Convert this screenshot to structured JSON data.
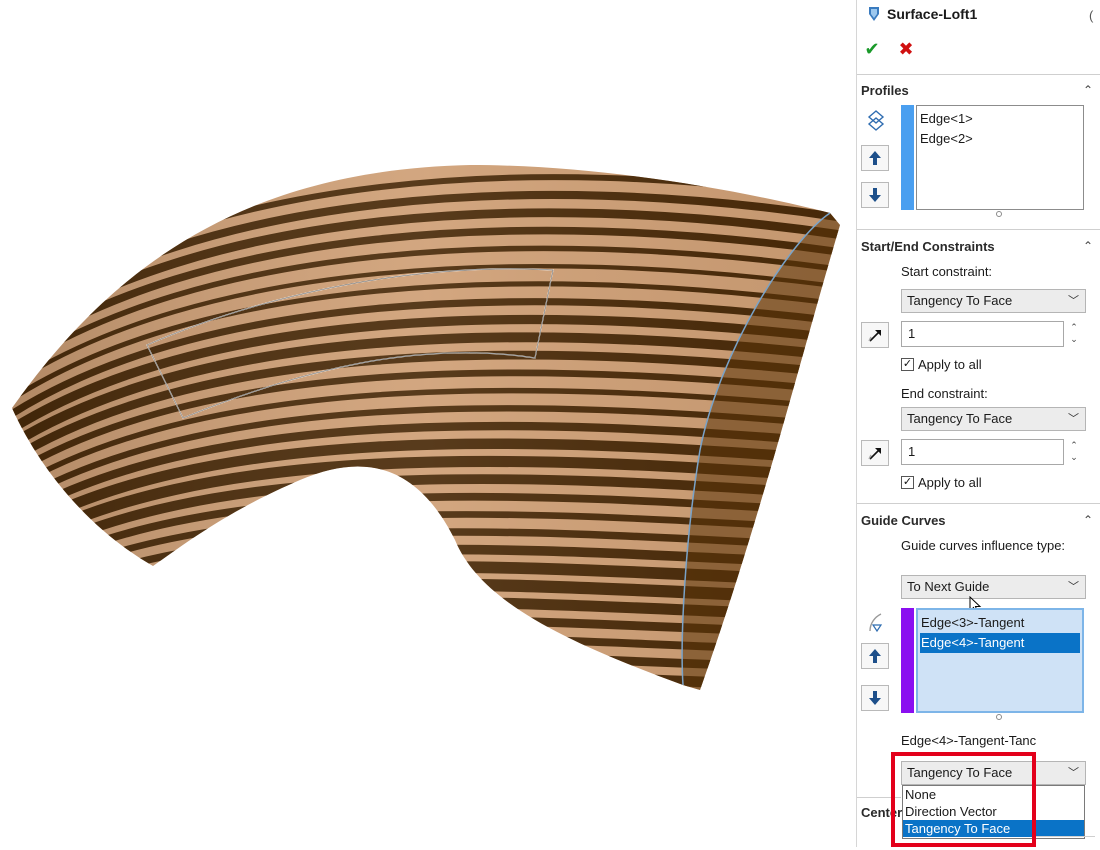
{
  "feature": {
    "title": "Surface-Loft1",
    "icon": "surface-loft-icon",
    "ok_icon": "checkmark-icon",
    "cancel_icon": "x-icon",
    "ok_glyph": "✔",
    "cancel_glyph": "✖"
  },
  "profiles": {
    "header": "Profiles",
    "items": [
      "Edge<1>",
      "Edge<2>"
    ],
    "bar_color": "#4a9ff0"
  },
  "constraints": {
    "header": "Start/End Constraints",
    "start_label": "Start constraint:",
    "start_value": "Tangency To Face",
    "start_length": "1",
    "start_apply_all": "Apply to all",
    "end_label": "End constraint:",
    "end_value": "Tangency To Face",
    "end_length": "1",
    "end_apply_all": "Apply to all"
  },
  "guides": {
    "header": "Guide Curves",
    "influence_label": "Guide curves influence type:",
    "influence_value": "To Next Guide",
    "items": [
      "Edge<3>-Tangent",
      "Edge<4>-Tangent"
    ],
    "selected_index": 1,
    "bar_color": "#8a0ff0",
    "edge_label": "Edge<4>-Tangent-Tanc",
    "edge_value": "Tangency To Face",
    "options": [
      "None",
      "Direction Vector",
      "Tangency To Face"
    ],
    "selected_option": "Tangency To Face"
  },
  "centerline": {
    "header_partial": "Center"
  },
  "colors": {
    "highlight": "#e3001b",
    "selection": "#0a73c7",
    "stripe_dark": "#4a2a08",
    "stripe_light": "#d6a57a"
  }
}
